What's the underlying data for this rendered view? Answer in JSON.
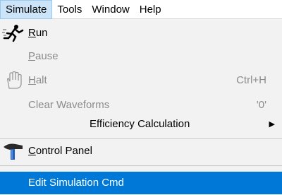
{
  "menubar": {
    "items": [
      {
        "label": "Simulate"
      },
      {
        "label": "Tools"
      },
      {
        "label": "Window"
      },
      {
        "label": "Help"
      }
    ]
  },
  "menu": {
    "run": {
      "accel": "R",
      "rest": "un",
      "icon": "runner-icon"
    },
    "pause": {
      "accel": "P",
      "rest": "ause"
    },
    "halt": {
      "accel": "H",
      "rest": "alt",
      "shortcut": "Ctrl+H",
      "icon": "hand-icon"
    },
    "clear": {
      "label": "Clear Waveforms",
      "shortcut": "'0'"
    },
    "efficiency": {
      "label": "Efficiency Calculation",
      "submenu_arrow": "▶"
    },
    "control_panel": {
      "accel": "C",
      "rest": "ontrol Panel",
      "icon": "hammer-icon"
    },
    "edit_cmd": {
      "label": "Edit Simulation Cmd"
    }
  },
  "colors": {
    "highlight": "#0078d7",
    "menubar_active": "#cce4f7",
    "disabled_text": "#8c8c8c",
    "menu_bg": "#f2f2f2"
  }
}
